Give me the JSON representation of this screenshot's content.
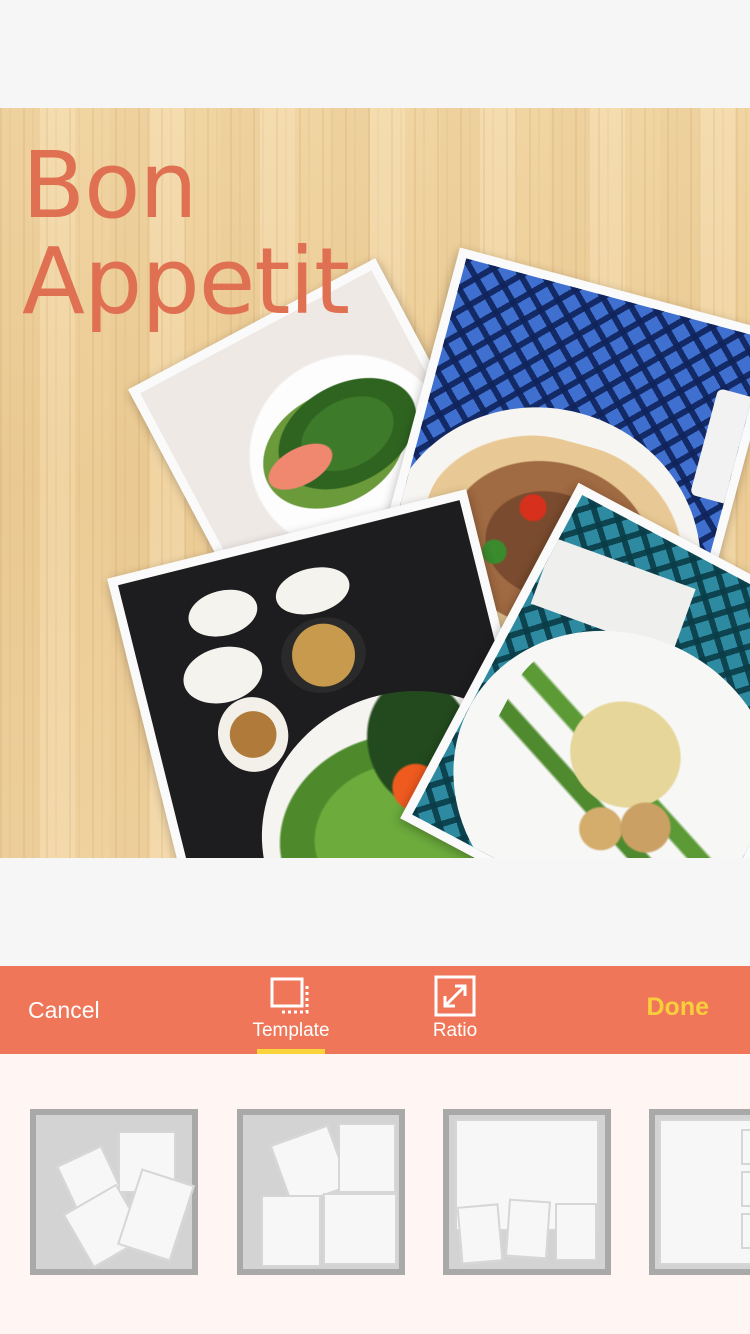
{
  "collage": {
    "title_line1": "Bon",
    "title_line2": "Appetit",
    "title_color": "#e07052",
    "photos": [
      "salad-photo",
      "taco-plate-photo",
      "bibimbap-photo",
      "asparagus-plate-photo"
    ]
  },
  "toolbar": {
    "cancel_label": "Cancel",
    "template_label": "Template",
    "ratio_label": "Ratio",
    "done_label": "Done",
    "background_color": "#ef7658",
    "done_color": "#f8cf3b",
    "indicator_color": "#f8d33a",
    "active_tab": "Template",
    "template_icon": "template-layout-icon",
    "ratio_icon": "expand-arrows-icon"
  },
  "templates": {
    "items": [
      "collage-template-1",
      "collage-template-2",
      "collage-template-3",
      "collage-template-4"
    ]
  }
}
